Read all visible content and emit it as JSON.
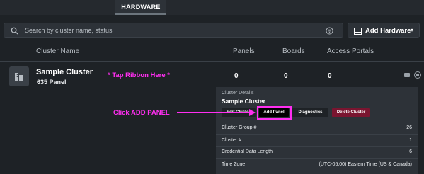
{
  "header": {
    "tab_label": "HARDWARE"
  },
  "toolbar": {
    "search_placeholder": "Search by cluster name, status",
    "add_hardware_label": "Add Hardware",
    "search_icon": "search-icon",
    "filter_icon": "filter-icon",
    "add_icon": "hardware-icon",
    "chevron_icon": "chevron-down-icon"
  },
  "table": {
    "columns": [
      "Cluster Name",
      "Panels",
      "Boards",
      "Access Portals"
    ],
    "rows": [
      {
        "name": "Sample Cluster",
        "subtitle": "635 Panel",
        "panels": "0",
        "boards": "0",
        "access_portals": "0"
      }
    ]
  },
  "annotations": {
    "tap_ribbon": "* Tap Ribbon Here *",
    "click_add": "Click ADD PANEL"
  },
  "details": {
    "header": "Cluster Details",
    "title": "Sample Cluster",
    "buttons": [
      "Edit Cluster",
      "Add Panel",
      "Diagnostics",
      "Delete Cluster"
    ],
    "fields": [
      {
        "label": "Cluster Group #",
        "value": "26"
      },
      {
        "label": "Cluster #",
        "value": "1"
      },
      {
        "label": "Credential Data Length",
        "value": "6"
      },
      {
        "label": "Time Zone",
        "value": "(UTC-05:00) Eastern Time (US & Canada)"
      }
    ]
  },
  "colors": {
    "background": "#1e2226",
    "panel": "#2d3238",
    "annotation": "#ff2ef0",
    "delete": "#7a1530"
  }
}
